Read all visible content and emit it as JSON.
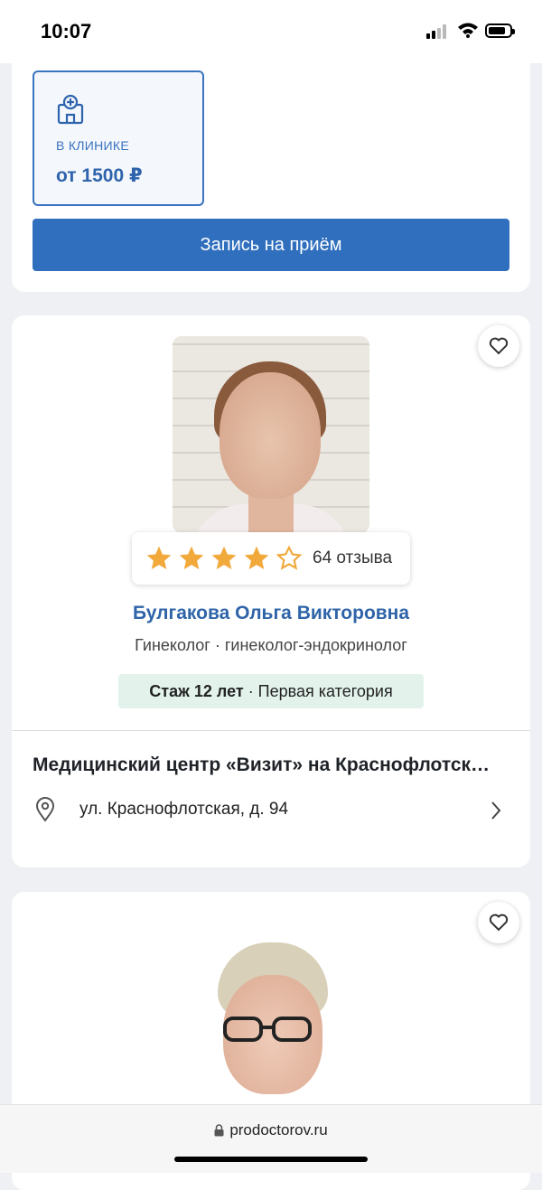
{
  "status_bar": {
    "time": "10:07"
  },
  "booking_card": {
    "mode_label": "В КЛИНИКЕ",
    "price": "от 1500 ₽",
    "book_button": "Запись на приём"
  },
  "doctor": {
    "rating_stars": 4,
    "rating_max": 5,
    "reviews": "64 отзыва",
    "name": "Булгакова Ольга Викторовна",
    "specialties": "Гинеколог · гинеколог-эндокринолог",
    "experience": "Стаж 12 лет",
    "category": " · Первая категория",
    "clinic": "Медицинский центр «Визит» на Краснофлотск…",
    "address": "ул. Краснофлотская, д. 94"
  },
  "browser": {
    "url": "prodoctorov.ru"
  },
  "colors": {
    "accent": "#2f6fbe",
    "star": "#f2a93b",
    "badge_bg": "#e3f3ec"
  }
}
